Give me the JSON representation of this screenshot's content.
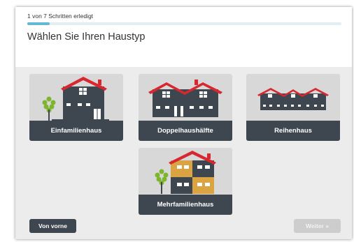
{
  "progress": {
    "text": "1 von 7 Schritten erledigt",
    "fraction": 0.0714
  },
  "title": "Wählen Sie Ihren Haustyp",
  "options": [
    {
      "label": "Einfamilienhaus",
      "icon": "single-family-house-icon"
    },
    {
      "label": "Doppelhaushälfte",
      "icon": "semi-detached-house-icon"
    },
    {
      "label": "Reihenhaus",
      "icon": "terraced-house-icon"
    },
    {
      "label": "Mehrfamilienhaus",
      "icon": "apartment-building-icon"
    }
  ],
  "buttons": {
    "back": "Von vorne",
    "next": "Weiter »"
  },
  "colors": {
    "roof": "#d7282f",
    "wall": "#3e4650",
    "accent_wall": "#d9a441",
    "tree": "#7fb52e",
    "progress": "#63b8d3"
  }
}
